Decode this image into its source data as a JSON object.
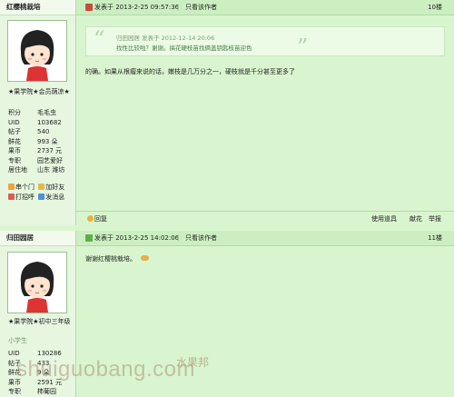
{
  "post1": {
    "author": "红樱桃栽培",
    "title": "★果学院★会员荫凉★",
    "stats": [
      {
        "k": "积分",
        "v": "毛毛虫"
      },
      {
        "k": "UID",
        "v": "103682"
      },
      {
        "k": "帖子",
        "v": "540"
      },
      {
        "k": "鲜花",
        "v": "993 朵"
      },
      {
        "k": "果币",
        "v": "2737 元"
      },
      {
        "k": "专职",
        "v": "园艺爱好"
      },
      {
        "k": "居住地",
        "v": "山东 潍坊"
      }
    ],
    "actions": [
      "串个门",
      "加好友",
      "打招呼",
      "发消息"
    ],
    "posted": "发表于 2013-2-25 09:57:36",
    "only_author": "只看该作者",
    "floor": "10楼",
    "quote_meta": "归田园居 发表于 2012-12-14 20:06",
    "quote_text": "找性比较啦？谢谢。搞花硬枝苗找俩盖钥匙枝苗迎色",
    "body": "的确。如果从根瘤来说的话，嫩枝是几万分之一，硬枝就是千分甚至更多了",
    "reply": "回复",
    "tools": "使用道具",
    "flower": "献花",
    "report": "举报"
  },
  "post2": {
    "author": "归田园居",
    "title": "★果学院★初中三年级",
    "subtitle": "小学生",
    "stats": [
      {
        "k": "UID",
        "v": "130286"
      },
      {
        "k": "帖子",
        "v": "433"
      },
      {
        "k": "鲜花",
        "v": "9 朵"
      },
      {
        "k": "果币",
        "v": "2591 元"
      },
      {
        "k": "专职",
        "v": "柿葡园"
      }
    ],
    "posted": "发表于 2013-2-25 14:02:06",
    "only_author": "只看该作者",
    "floor": "11楼",
    "body": "谢谢红樱桃栽培。"
  },
  "watermark": {
    "text": "shuiguobang.com",
    "sub": "水果邦"
  }
}
